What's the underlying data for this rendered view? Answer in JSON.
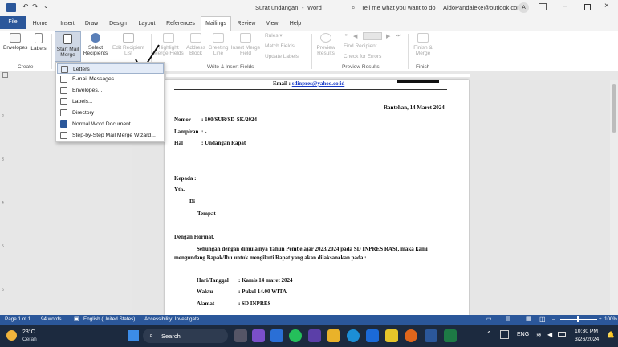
{
  "title_bar": {
    "doc_title": "Surat undangan",
    "sep": "-",
    "app": "Word",
    "search_placeholder": "Tell me what you want to do",
    "account": "AldoPandaleke@outlook.com",
    "avatar": "A"
  },
  "tabs": [
    "File",
    "Home",
    "Insert",
    "Draw",
    "Design",
    "Layout",
    "References",
    "Mailings",
    "Review",
    "View",
    "Help"
  ],
  "ribbon": {
    "create": {
      "envelopes": "Envelopes",
      "labels": "Labels",
      "group": "Create"
    },
    "start": {
      "start_mail_merge": "Start Mail Merge",
      "select_recipients": "Select Recipients",
      "edit_recipient_list": "Edit Recipient List"
    },
    "write_insert": {
      "highlight": "Highlight Merge Fields",
      "address": "Address Block",
      "greeting": "Greeting Line",
      "insert_merge": "Insert Merge Field",
      "rules": "Rules",
      "match": "Match Fields",
      "update": "Update Labels",
      "group": "Write & Insert Fields"
    },
    "preview": {
      "preview_results": "Preview Results",
      "find_recipient": "Find Recipient",
      "check_errors": "Check for Errors",
      "group": "Preview Results"
    },
    "finish": {
      "finish_merge": "Finish & Merge",
      "group": "Finish"
    }
  },
  "dropdown": [
    "Letters",
    "E-mail Messages",
    "Envelopes...",
    "Labels...",
    "Directory",
    "Normal Word Document",
    "Step-by-Step Mail Merge Wizard..."
  ],
  "document": {
    "email_label": "Email :",
    "email_value": "sdinpres@yahoo.co.id",
    "date": "Rantehan, 14 Maret 2024",
    "nomor_label": "Nomor",
    "nomor_value": ": 100/SUR/SD-SK/2024",
    "lampiran_label": "Lampiran",
    "lampiran_value": ": -",
    "hal_label": "Hal",
    "hal_value": ": Undangan Rapat",
    "kepada": "Kepada :",
    "yth": "Yth.",
    "di": "Di –",
    "tempat": "Tempat",
    "salam": "Dengan Hormat,",
    "body1": "Sehungan dengan dimulainya Tahun Pembelajar 2023/2024 pada SD INPRES RASI, maka kami",
    "body2": "mengundang Bapak/Ibu untuk mengikuti Rapat yang akan dilaksanakan pada :",
    "hari_label": "Hari/Tanggal",
    "hari_value": ": Kamis 14 maret 2024",
    "waktu_label": "Waktu",
    "waktu_value": ": Pukul 14.00 WITA",
    "alamat_label": "Alamat",
    "alamat_value": ": SD INPRES"
  },
  "status_bar": {
    "page": "Page 1 of 1",
    "words": "94 words",
    "language": "English (United States)",
    "accessibility": "Accessibility: Investigate",
    "zoom": "100%"
  },
  "taskbar": {
    "temp": "23°C",
    "weather": "Cerah",
    "search": "Search",
    "lang": "ENG",
    "time": "10:30 PM",
    "date": "3/26/2024"
  },
  "colors": {
    "word_blue": "#2b579a",
    "taskbar": "#1c2a3f",
    "link": "#1a3cc8"
  }
}
